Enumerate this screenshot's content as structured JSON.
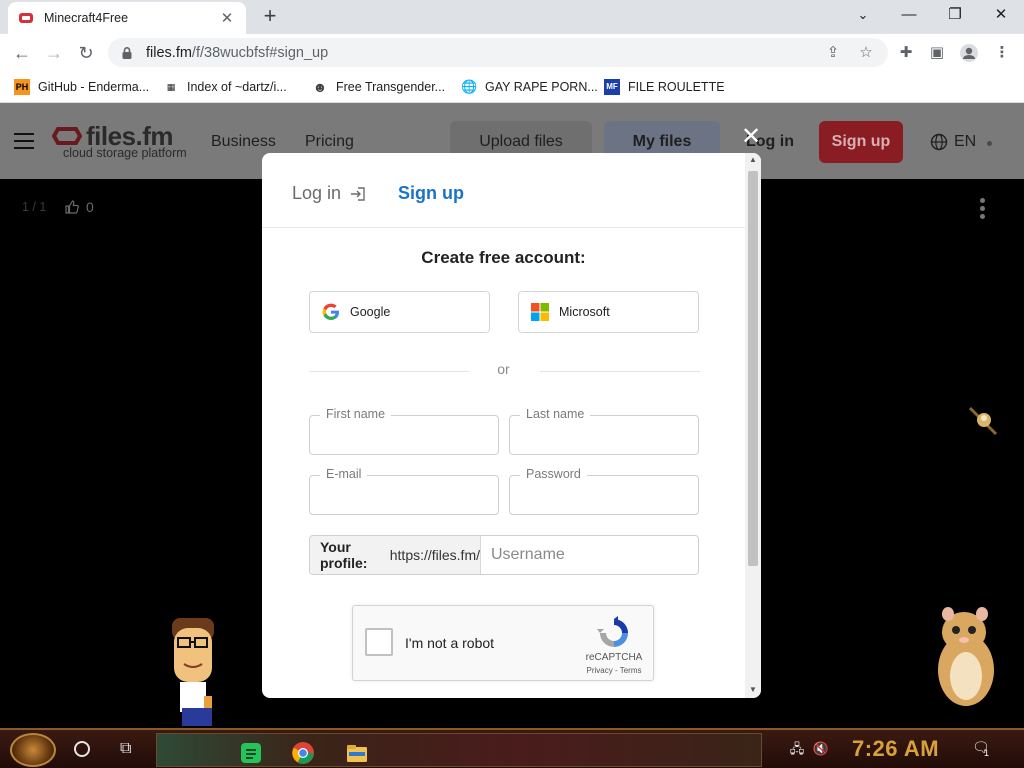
{
  "browser": {
    "tab_title": "Minecraft4Free",
    "tab_close": "✕",
    "new_tab": "+",
    "win_min": "—",
    "win_restore": "❐",
    "win_close": "✕",
    "url_host": "files.fm",
    "url_path": "/f/38wucbfsf#sign_up",
    "bookmarks": [
      {
        "label": "GitHub - Enderma...",
        "icon_text": "PH",
        "icon_color": "#f7941d"
      },
      {
        "label": "Index of ~dartz/i...",
        "icon_text": "▦",
        "icon_color": "#222222"
      },
      {
        "label": "Free Transgender...",
        "icon_text": "☻",
        "icon_color": "#444444"
      },
      {
        "label": "GAY RAPE PORN...",
        "icon_text": "🌐",
        "icon_color": "#5f6368"
      },
      {
        "label": "FILE ROULETTE",
        "icon_text": "MF",
        "icon_color": "#1a3fa8"
      }
    ]
  },
  "site": {
    "logo_text": "files.fm",
    "logo_sub": "cloud storage platform",
    "nav_business": "Business",
    "nav_pricing": "Pricing",
    "upload_label": "Upload files",
    "myfiles_label": "My files",
    "login_label": "Log in",
    "signup_label": "Sign up",
    "lang_label": "EN",
    "counter": "1 / 1",
    "likes": "0"
  },
  "modal": {
    "close": "✕",
    "tab_login": "Log in",
    "tab_signup": "Sign up",
    "title": "Create free account:",
    "google_label": "Google",
    "microsoft_label": "Microsoft",
    "or_text": "or",
    "first_name_label": "First name",
    "last_name_label": "Last name",
    "email_label": "E-mail",
    "password_label": "Password",
    "profile_label": "Your profile:",
    "profile_url": "https://files.fm/",
    "username_placeholder": "Username",
    "captcha_text": "I'm not a robot",
    "captcha_brand": "reCAPTCHA",
    "captcha_links": "Privacy - Terms"
  },
  "taskbar": {
    "clock": "7:26 AM",
    "notif_count": "1"
  },
  "colors": {
    "accent_blue": "#1a73c8",
    "signup_red": "#8a1c24",
    "clock_gold": "#d8a23a"
  }
}
